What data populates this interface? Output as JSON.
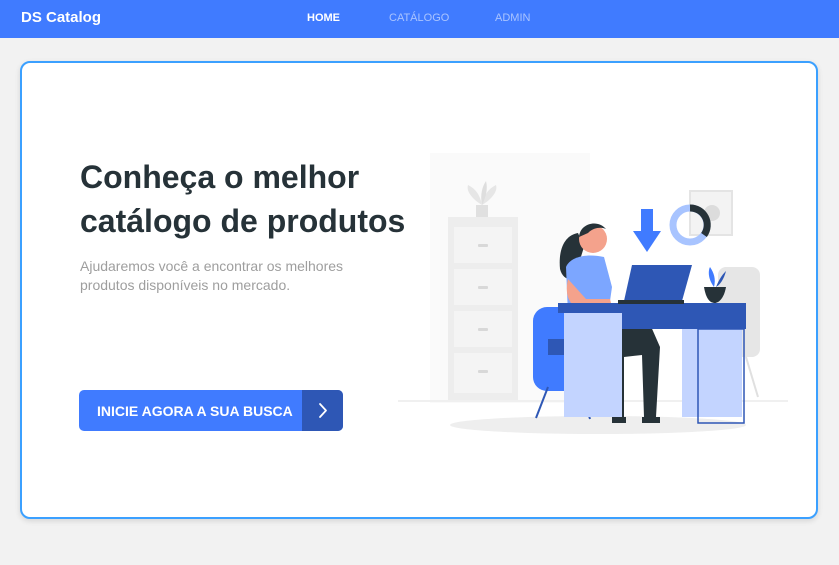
{
  "navbar": {
    "brand": "DS Catalog",
    "links": [
      {
        "label": "HOME",
        "active": true
      },
      {
        "label": "CATÁLOGO",
        "active": false
      },
      {
        "label": "ADMIN",
        "active": false
      }
    ],
    "background_color": "#407bff"
  },
  "hero": {
    "title": "Conheça o melhor catálogo de produtos",
    "subtitle": "Ajudaremos você a encontrar os melhores produtos disponíveis no mercado.",
    "cta_label": "INICIE AGORA A SUA BUSCA",
    "cta_icon": "chevron-right-icon",
    "illustration": "woman-at-desk-with-laptop-illustration"
  },
  "colors": {
    "primary": "#407bff",
    "primary_dark": "#2e57b5",
    "card_border": "#3ba0ff",
    "title_text": "#263238",
    "muted_text": "#9e9e9e",
    "page_background": "#f2f2f2"
  }
}
